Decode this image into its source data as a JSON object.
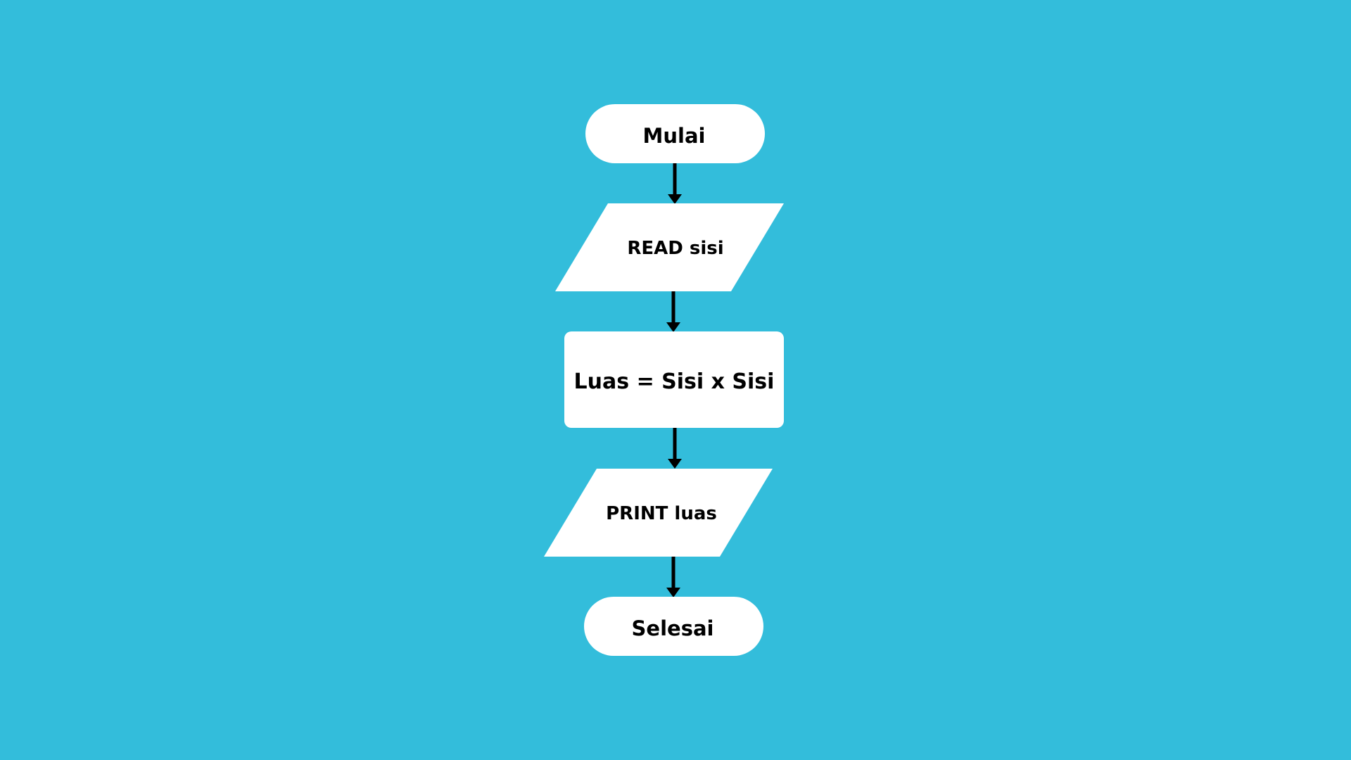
{
  "background_color": "#33BDDB",
  "shape_color": "#FFFFFF",
  "text_color": "#000000",
  "flowchart": {
    "start": {
      "shape": "terminator",
      "label": "Mulai"
    },
    "input": {
      "shape": "parallelogram",
      "label": "READ sisi"
    },
    "process": {
      "shape": "rectangle",
      "label": "Luas = Sisi x Sisi"
    },
    "output": {
      "shape": "parallelogram",
      "label": "PRINT luas"
    },
    "end": {
      "shape": "terminator",
      "label": "Selesai"
    }
  }
}
